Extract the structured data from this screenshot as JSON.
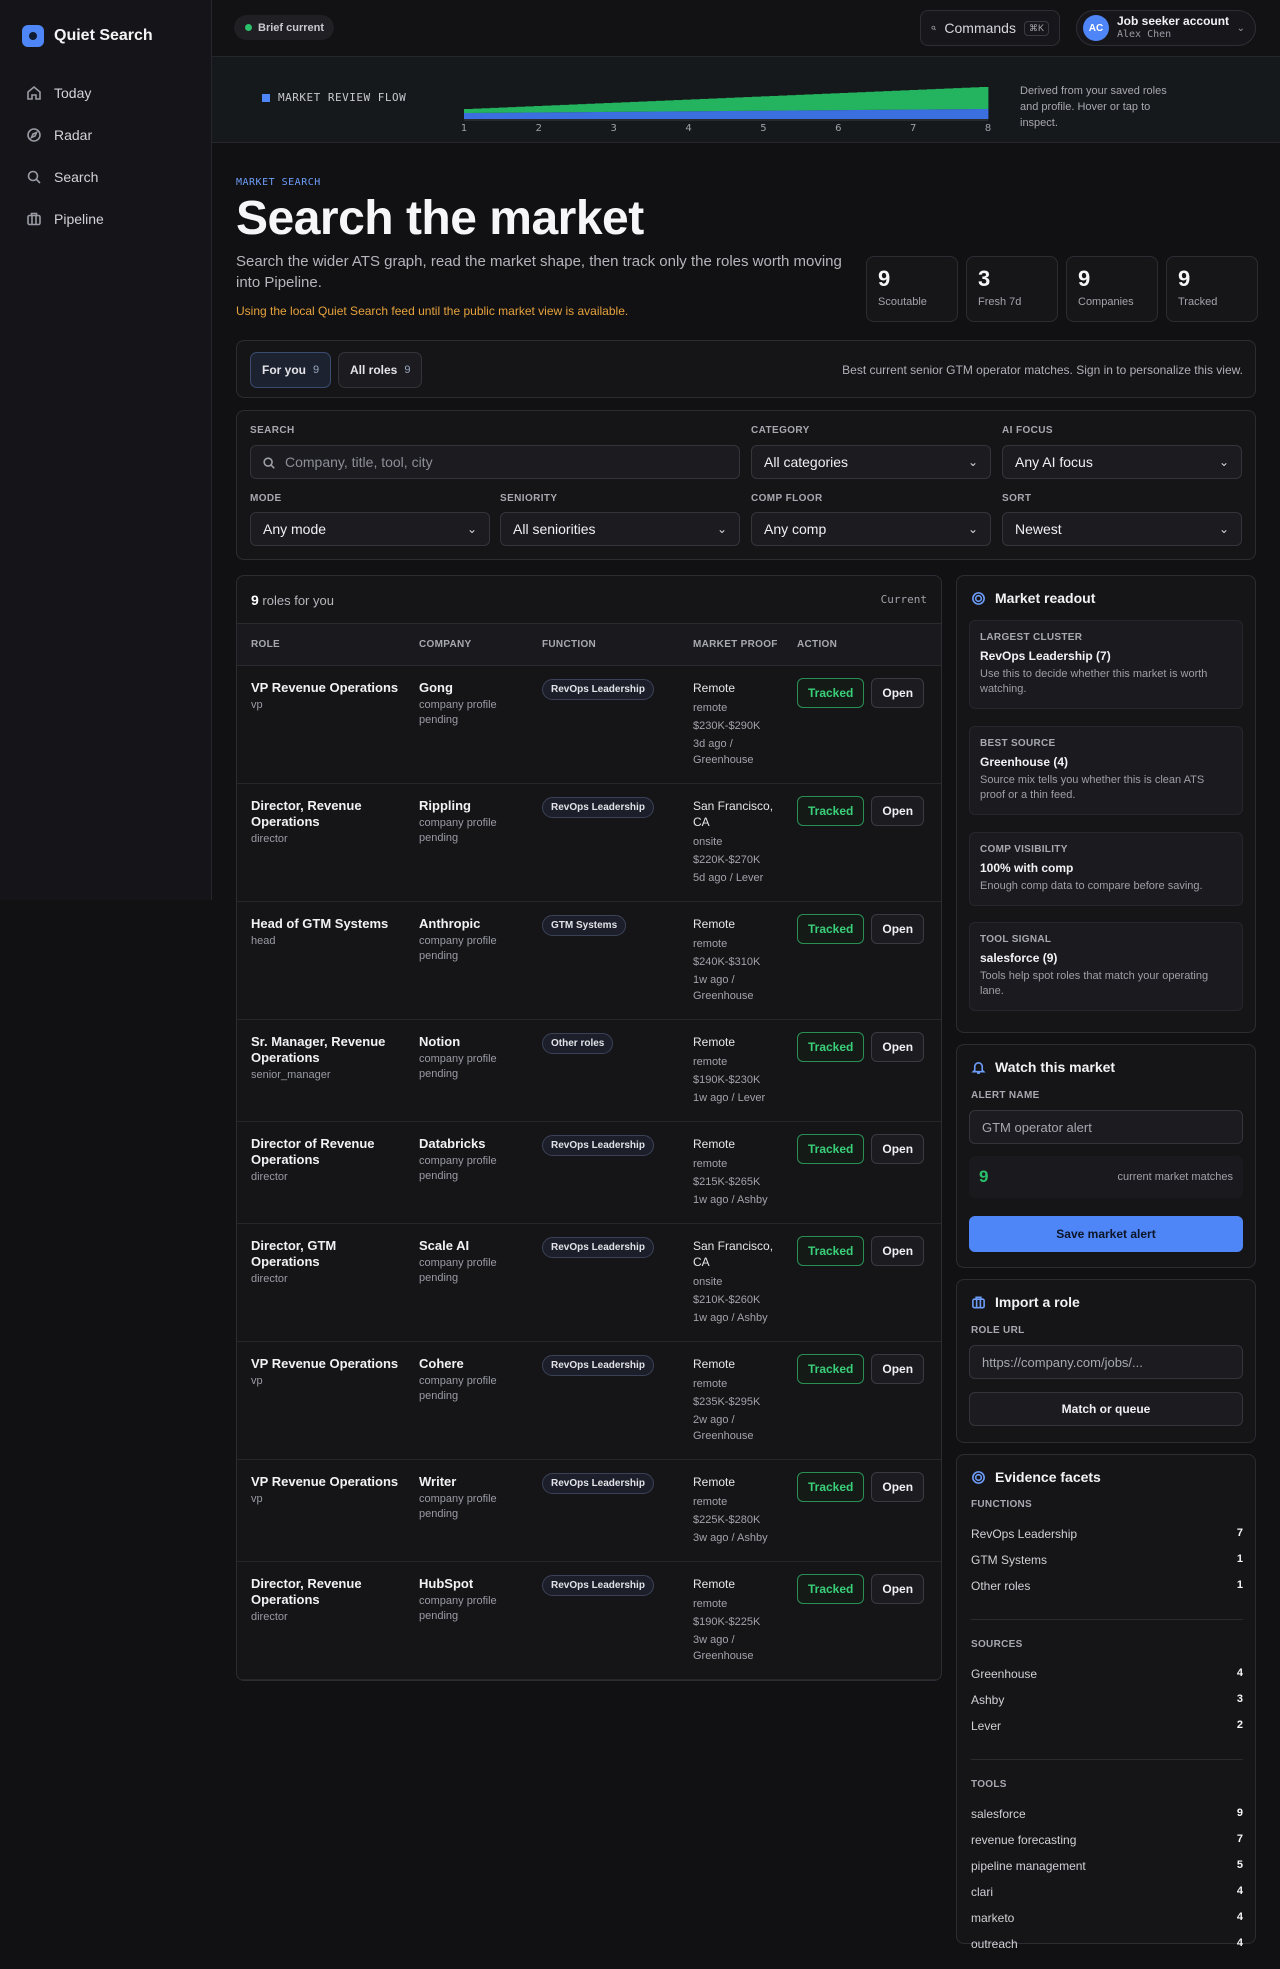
{
  "app": {
    "name": "Quiet Search"
  },
  "sidebar": {
    "items": [
      {
        "label": "Today",
        "icon": "home-icon"
      },
      {
        "label": "Radar",
        "icon": "compass-icon"
      },
      {
        "label": "Search",
        "icon": "search-icon"
      },
      {
        "label": "Pipeline",
        "icon": "briefcase-icon"
      }
    ]
  },
  "topbar": {
    "brief_label": "Brief current",
    "brief_status_color": "#2bc16b",
    "commands_label": "Commands",
    "commands_shortcut": "⌘K",
    "account_initials": "AC",
    "account_title": "Job seeker account",
    "account_name": "Alex Chen"
  },
  "flow": {
    "label": "MARKET REVIEW FLOW",
    "note": "Derived from your saved roles and profile. Hover or tap to inspect.",
    "axis_ticks": [
      "1",
      "2",
      "3",
      "4",
      "5",
      "6",
      "7",
      "8"
    ]
  },
  "page": {
    "eyebrow": "MARKET SEARCH",
    "title": "Search the market",
    "description": "Search the wider ATS graph, read the market shape, then track only the roles worth moving into Pipeline.",
    "warning": "Using the local Quiet Search feed until the public market view is available."
  },
  "stats": [
    {
      "value": "9",
      "label": "Scoutable"
    },
    {
      "value": "3",
      "label": "Fresh 7d"
    },
    {
      "value": "9",
      "label": "Companies"
    },
    {
      "value": "9",
      "label": "Tracked"
    }
  ],
  "tabs": [
    {
      "label": "For you",
      "count": "9"
    },
    {
      "label": "All roles",
      "count": "9"
    }
  ],
  "tabs_note": "Best current senior GTM operator matches. Sign in to personalize this view.",
  "filters": {
    "search": {
      "label": "SEARCH",
      "placeholder": "Company, title, tool, city"
    },
    "category": {
      "label": "CATEGORY",
      "value": "All categories"
    },
    "ai_focus": {
      "label": "AI FOCUS",
      "value": "Any AI focus"
    },
    "mode": {
      "label": "MODE",
      "value": "Any mode"
    },
    "seniority": {
      "label": "SENIORITY",
      "value": "All seniorities"
    },
    "comp_floor": {
      "label": "COMP FLOOR",
      "value": "Any comp"
    },
    "sort": {
      "label": "SORT",
      "value": "Newest"
    }
  },
  "results": {
    "count": "9",
    "count_suffix": "roles for you",
    "status": "Current",
    "columns": [
      "ROLE",
      "COMPANY",
      "FUNCTION",
      "MARKET PROOF",
      "ACTION"
    ],
    "tracked_label": "Tracked",
    "open_label": "Open",
    "rows": [
      {
        "title": "VP Revenue Operations",
        "level": "vp",
        "company": "Gong",
        "company_note": "company profile pending",
        "function": "RevOps Leadership",
        "location": "Remote",
        "mode": "remote",
        "comp": "$230K-$290K",
        "source": "3d ago / Greenhouse"
      },
      {
        "title": "Director, Revenue Operations",
        "level": "director",
        "company": "Rippling",
        "company_note": "company profile pending",
        "function": "RevOps Leadership",
        "location": "San Francisco, CA",
        "mode": "onsite",
        "comp": "$220K-$270K",
        "source": "5d ago / Lever"
      },
      {
        "title": "Head of GTM Systems",
        "level": "head",
        "company": "Anthropic",
        "company_note": "company profile pending",
        "function": "GTM Systems",
        "location": "Remote",
        "mode": "remote",
        "comp": "$240K-$310K",
        "source": "1w ago / Greenhouse"
      },
      {
        "title": "Sr. Manager, Revenue Operations",
        "level": "senior_manager",
        "company": "Notion",
        "company_note": "company profile pending",
        "function": "Other roles",
        "location": "Remote",
        "mode": "remote",
        "comp": "$190K-$230K",
        "source": "1w ago / Lever"
      },
      {
        "title": "Director of Revenue Operations",
        "level": "director",
        "company": "Databricks",
        "company_note": "company profile pending",
        "function": "RevOps Leadership",
        "location": "Remote",
        "mode": "remote",
        "comp": "$215K-$265K",
        "source": "1w ago / Ashby"
      },
      {
        "title": "Director, GTM Operations",
        "level": "director",
        "company": "Scale AI",
        "company_note": "company profile pending",
        "function": "RevOps Leadership",
        "location": "San Francisco, CA",
        "mode": "onsite",
        "comp": "$210K-$260K",
        "source": "1w ago / Ashby"
      },
      {
        "title": "VP Revenue Operations",
        "level": "vp",
        "company": "Cohere",
        "company_note": "company profile pending",
        "function": "RevOps Leadership",
        "location": "Remote",
        "mode": "remote",
        "comp": "$235K-$295K",
        "source": "2w ago / Greenhouse"
      },
      {
        "title": "VP Revenue Operations",
        "level": "vp",
        "company": "Writer",
        "company_note": "company profile pending",
        "function": "RevOps Leadership",
        "location": "Remote",
        "mode": "remote",
        "comp": "$225K-$280K",
        "source": "3w ago / Ashby"
      },
      {
        "title": "Director, Revenue Operations",
        "level": "director",
        "company": "HubSpot",
        "company_note": "company profile pending",
        "function": "RevOps Leadership",
        "location": "Remote",
        "mode": "remote",
        "comp": "$190K-$225K",
        "source": "3w ago / Greenhouse"
      }
    ]
  },
  "readout": {
    "title": "Market readout",
    "items": [
      {
        "key": "LARGEST CLUSTER",
        "value": "RevOps Leadership (7)",
        "desc": "Use this to decide whether this market is worth watching."
      },
      {
        "key": "BEST SOURCE",
        "value": "Greenhouse (4)",
        "desc": "Source mix tells you whether this is clean ATS proof or a thin feed."
      },
      {
        "key": "COMP VISIBILITY",
        "value": "100% with comp",
        "desc": "Enough comp data to compare before saving."
      },
      {
        "key": "TOOL SIGNAL",
        "value": "salesforce (9)",
        "desc": "Tools help spot roles that match your operating lane."
      }
    ]
  },
  "watch": {
    "title": "Watch this market",
    "field_label": "ALERT NAME",
    "field_value": "GTM operator alert",
    "match_count": "9",
    "match_label": "current market matches",
    "button": "Save market alert"
  },
  "import": {
    "title": "Import a role",
    "field_label": "ROLE URL",
    "placeholder": "https://company.com/jobs/...",
    "button": "Match or queue"
  },
  "facets": {
    "title": "Evidence facets",
    "groups": [
      {
        "label": "FUNCTIONS",
        "items": [
          {
            "name": "RevOps Leadership",
            "count": "7"
          },
          {
            "name": "GTM Systems",
            "count": "1"
          },
          {
            "name": "Other roles",
            "count": "1"
          }
        ]
      },
      {
        "label": "SOURCES",
        "items": [
          {
            "name": "Greenhouse",
            "count": "4"
          },
          {
            "name": "Ashby",
            "count": "3"
          },
          {
            "name": "Lever",
            "count": "2"
          }
        ]
      },
      {
        "label": "TOOLS",
        "items": [
          {
            "name": "salesforce",
            "count": "9"
          },
          {
            "name": "revenue forecasting",
            "count": "7"
          },
          {
            "name": "pipeline management",
            "count": "5"
          },
          {
            "name": "clari",
            "count": "4"
          },
          {
            "name": "marketo",
            "count": "4"
          },
          {
            "name": "outreach",
            "count": "4"
          }
        ]
      }
    ]
  },
  "colors": {
    "accent": "#4f86f7",
    "success": "#2bc16b",
    "warning": "#e6a23c"
  }
}
